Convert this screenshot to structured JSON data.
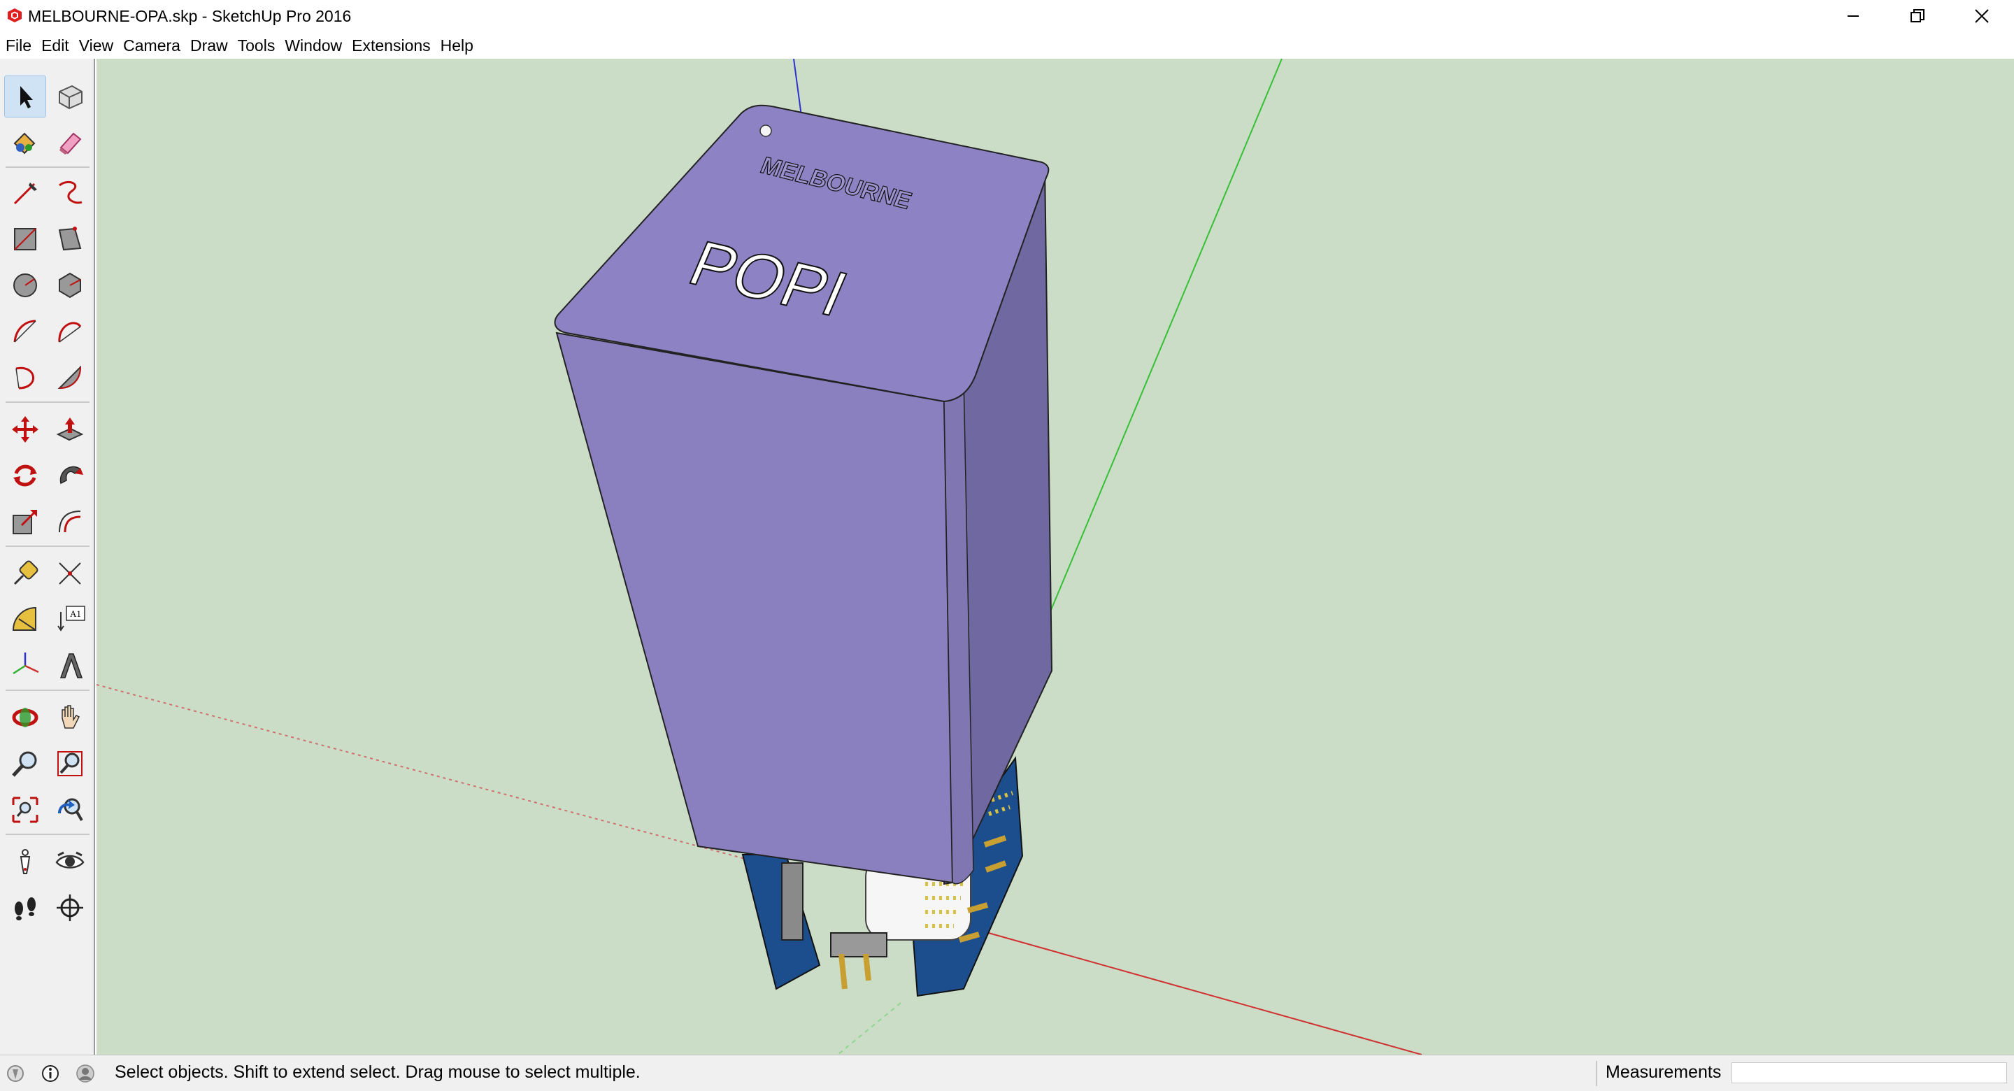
{
  "window": {
    "title": "MELBOURNE-OPA.skp - SketchUp Pro 2016",
    "controls": [
      "minimize",
      "restore",
      "close"
    ]
  },
  "menu": {
    "items": [
      "File",
      "Edit",
      "View",
      "Camera",
      "Draw",
      "Tools",
      "Window",
      "Extensions",
      "Help"
    ]
  },
  "toolbar": {
    "tools": [
      {
        "name": "select-icon",
        "active": true
      },
      {
        "name": "make-component-icon"
      },
      {
        "name": "paint-bucket-icon"
      },
      {
        "name": "eraser-icon"
      },
      {
        "name": "line-icon"
      },
      {
        "name": "freehand-icon"
      },
      {
        "name": "rectangle-icon"
      },
      {
        "name": "rotated-rectangle-icon"
      },
      {
        "name": "circle-icon"
      },
      {
        "name": "polygon-icon"
      },
      {
        "name": "arc-icon"
      },
      {
        "name": "two-point-arc-icon"
      },
      {
        "name": "three-point-arc-icon"
      },
      {
        "name": "pie-icon"
      },
      {
        "name": "move-icon"
      },
      {
        "name": "push-pull-icon"
      },
      {
        "name": "rotate-icon"
      },
      {
        "name": "follow-me-icon"
      },
      {
        "name": "scale-icon"
      },
      {
        "name": "offset-icon"
      },
      {
        "name": "tape-measure-icon"
      },
      {
        "name": "dimension-icon"
      },
      {
        "name": "protractor-icon"
      },
      {
        "name": "text-icon",
        "label": "A1"
      },
      {
        "name": "axes-icon"
      },
      {
        "name": "3d-text-icon"
      },
      {
        "name": "orbit-icon"
      },
      {
        "name": "pan-icon"
      },
      {
        "name": "zoom-icon"
      },
      {
        "name": "zoom-window-icon"
      },
      {
        "name": "zoom-extents-icon"
      },
      {
        "name": "previous-view-icon"
      },
      {
        "name": "position-camera-icon"
      },
      {
        "name": "look-around-icon"
      },
      {
        "name": "walk-icon"
      },
      {
        "name": "section-plane-icon"
      }
    ]
  },
  "viewport": {
    "background": "#cbdcc7",
    "model": {
      "engraved_text_1": "MELBOURNE",
      "engraved_text_2": "POPI",
      "body_color": "#8b80bf",
      "top_color": "#8c82c4",
      "side_color": "#7068a0"
    },
    "axes": {
      "red": "#d03030",
      "green": "#36c036",
      "blue": "#3030d0"
    }
  },
  "status": {
    "message": "Select objects. Shift to extend select. Drag mouse to select multiple.",
    "measurements_label": "Measurements",
    "measurements_value": ""
  }
}
